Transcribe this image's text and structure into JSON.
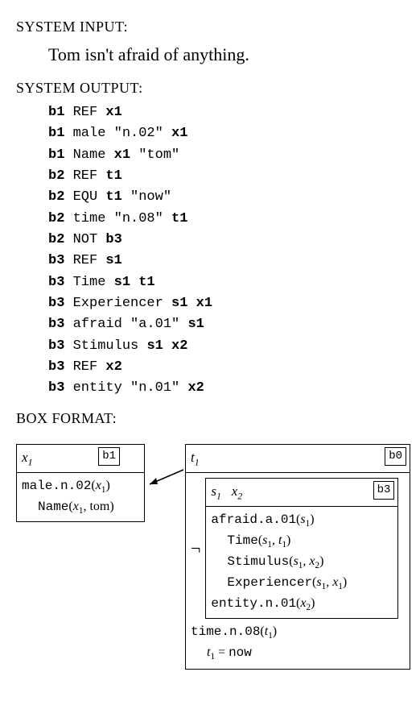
{
  "labels": {
    "system_input": "SYSTEM INPUT:",
    "system_output": "SYSTEM OUTPUT:",
    "box_format": "BOX FORMAT:"
  },
  "input_sentence": "Tom isn't afraid of anything.",
  "output_lines": [
    [
      {
        "bold": true,
        "text": "b1"
      },
      {
        "bold": false,
        "text": " REF "
      },
      {
        "bold": true,
        "text": "x1"
      }
    ],
    [
      {
        "bold": true,
        "text": "b1"
      },
      {
        "bold": false,
        "text": " male \"n.02\" "
      },
      {
        "bold": true,
        "text": "x1"
      }
    ],
    [
      {
        "bold": true,
        "text": "b1"
      },
      {
        "bold": false,
        "text": " Name "
      },
      {
        "bold": true,
        "text": "x1"
      },
      {
        "bold": false,
        "text": " \"tom\""
      }
    ],
    [
      {
        "bold": true,
        "text": "b2"
      },
      {
        "bold": false,
        "text": " REF "
      },
      {
        "bold": true,
        "text": "t1"
      }
    ],
    [
      {
        "bold": true,
        "text": "b2"
      },
      {
        "bold": false,
        "text": " EQU "
      },
      {
        "bold": true,
        "text": "t1"
      },
      {
        "bold": false,
        "text": " \"now\""
      }
    ],
    [
      {
        "bold": true,
        "text": "b2"
      },
      {
        "bold": false,
        "text": " time \"n.08\" "
      },
      {
        "bold": true,
        "text": "t1"
      }
    ],
    [
      {
        "bold": true,
        "text": "b2"
      },
      {
        "bold": false,
        "text": " NOT "
      },
      {
        "bold": true,
        "text": "b3"
      }
    ],
    [
      {
        "bold": true,
        "text": "b3"
      },
      {
        "bold": false,
        "text": " REF "
      },
      {
        "bold": true,
        "text": "s1"
      }
    ],
    [
      {
        "bold": true,
        "text": "b3"
      },
      {
        "bold": false,
        "text": " Time "
      },
      {
        "bold": true,
        "text": "s1 t1"
      }
    ],
    [
      {
        "bold": true,
        "text": "b3"
      },
      {
        "bold": false,
        "text": " Experiencer "
      },
      {
        "bold": true,
        "text": "s1 x1"
      }
    ],
    [
      {
        "bold": true,
        "text": "b3"
      },
      {
        "bold": false,
        "text": " afraid \"a.01\" "
      },
      {
        "bold": true,
        "text": "s1"
      }
    ],
    [
      {
        "bold": true,
        "text": "b3"
      },
      {
        "bold": false,
        "text": " Stimulus "
      },
      {
        "bold": true,
        "text": "s1 x2"
      }
    ],
    [
      {
        "bold": true,
        "text": "b3"
      },
      {
        "bold": false,
        "text": " REF "
      },
      {
        "bold": true,
        "text": "x2"
      }
    ],
    [
      {
        "bold": true,
        "text": "b3"
      },
      {
        "bold": false,
        "text": " entity \"n.01\" "
      },
      {
        "bold": true,
        "text": "x2"
      }
    ]
  ],
  "boxes": {
    "b1": {
      "tag": "b1",
      "refs_html": "<i>x</i><span class='sub'>1</span>",
      "body_html": "<div class='line'><span class='tt'>male.n.02</span>(<i>x</i><span class='sub'>1</span>)</div><div class='line indent'><span class='tt'>Name</span>(<i>x</i><span class='sub'>1</span>, tom)</div>"
    },
    "b0": {
      "tag": "b0",
      "refs_html": "<i>t</i><span class='sub'>1</span>",
      "footer_html": "<div class='line'><span class='tt'>time.n.08</span>(<i>t</i><span class='sub'>1</span>)</div><div class='line indent'><i>t</i><span class='sub'>1</span> = <span class='tt'>now</span></div>"
    },
    "b3": {
      "tag": "b3",
      "refs_html": "<i>s</i><span class='sub'>1</span>&nbsp;&nbsp;&nbsp;<i>x</i><span class='sub'>2</span>",
      "body_html": "<div class='line'><span class='tt'>afraid.a.01</span>(<i>s</i><span class='sub'>1</span>)</div><div class='line indent'><span class='tt'>Time</span>(<i>s</i><span class='sub'>1</span>, <i>t</i><span class='sub'>1</span>)</div><div class='line indent'><span class='tt'>Stimulus</span>(<i>s</i><span class='sub'>1</span>, <i>x</i><span class='sub'>2</span>)</div><div class='line indent'><span class='tt'>Experiencer</span>(<i>s</i><span class='sub'>1</span>, <i>x</i><span class='sub'>1</span>)</div><div class='line'><span class='tt'>entity.n.01</span>(<i>x</i><span class='sub'>2</span>)</div>"
    },
    "neg": "¬"
  }
}
